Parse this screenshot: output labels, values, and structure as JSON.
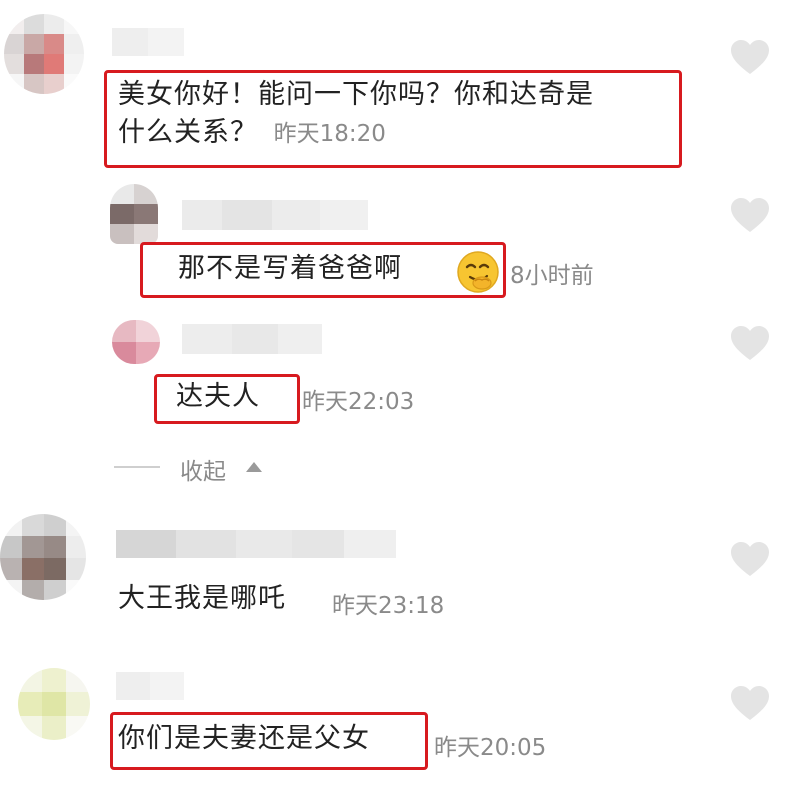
{
  "colors": {
    "highlight": "#d71a1f",
    "text": "#222222",
    "meta": "#8a8a8a",
    "heart": "#e4e4e4"
  },
  "comments": [
    {
      "text_line1": "美女你好！能问一下你吗？你和达奇是",
      "text_line2": "什么关系？",
      "time": "昨天18:20"
    },
    {
      "text": "那不是写着爸爸啊",
      "emoji": "smirking-face",
      "time": "8小时前"
    },
    {
      "text": "达夫人",
      "time": "昨天22:03"
    },
    {
      "text": "大王我是哪吒",
      "time": "昨天23:18"
    },
    {
      "text": "你们是夫妻还是父女",
      "time": "昨天20:05"
    }
  ],
  "collapse": {
    "label": "收起"
  }
}
